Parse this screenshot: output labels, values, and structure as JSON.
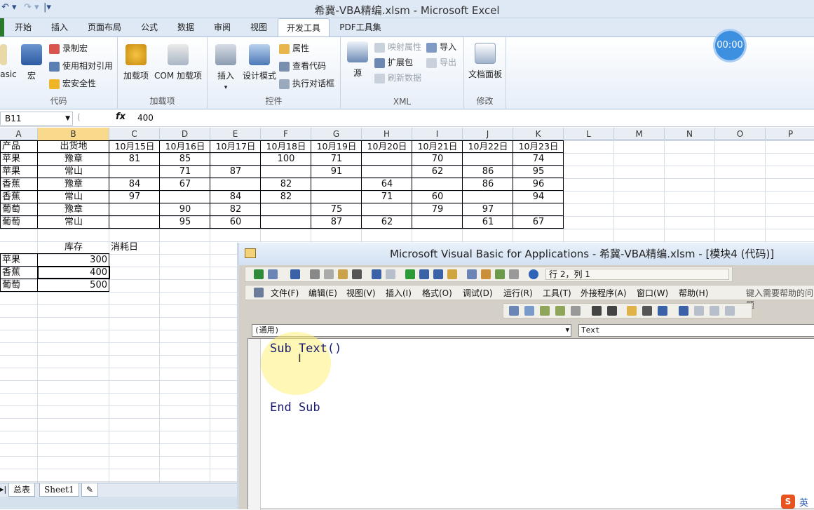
{
  "window": {
    "title": "希冀-VBA精编.xlsm - Microsoft Excel"
  },
  "ribbon": {
    "tabs": [
      "开始",
      "插入",
      "页面布局",
      "公式",
      "数据",
      "审阅",
      "视图",
      "开发工具",
      "PDF工具集"
    ],
    "active_tab": "开发工具",
    "groups": {
      "code": {
        "label": "代码",
        "basic": "asic",
        "macro": "宏",
        "record": "录制宏",
        "relative": "使用相对引用",
        "security": "宏安全性"
      },
      "addins": {
        "label": "加载项",
        "addin": "加载项",
        "com": "COM 加载项"
      },
      "controls": {
        "label": "控件",
        "insert": "插入",
        "design": "设计模式",
        "props": "属性",
        "viewcode": "查看代码",
        "dialog": "执行对话框"
      },
      "xml": {
        "label": "XML",
        "source": "源",
        "mapprops": "映射属性",
        "expand": "扩展包",
        "refresh": "刷新数据",
        "import": "导入",
        "export": "导出"
      },
      "modify": {
        "label": "修改",
        "docpanel": "文档面板"
      }
    }
  },
  "timer": "00:00",
  "formula_bar": {
    "name_box": "B11",
    "fx": "fx",
    "value": "400"
  },
  "grid": {
    "columns": [
      "A",
      "B",
      "C",
      "D",
      "E",
      "F",
      "G",
      "H",
      "I",
      "J",
      "K",
      "L",
      "M",
      "N",
      "O",
      "P"
    ],
    "header_row": [
      "产品",
      "出货地",
      "10月15日",
      "10月16日",
      "10月17日",
      "10月18日",
      "10月19日",
      "10月20日",
      "10月21日",
      "10月22日",
      "10月23日"
    ],
    "rows": [
      [
        "苹果",
        "豫章",
        "81",
        "85",
        "",
        "100",
        "71",
        "",
        "70",
        "",
        "74"
      ],
      [
        "苹果",
        "常山",
        "",
        "71",
        "87",
        "",
        "91",
        "",
        "62",
        "86",
        "95"
      ],
      [
        "香蕉",
        "豫章",
        "84",
        "67",
        "",
        "82",
        "",
        "64",
        "",
        "86",
        "96"
      ],
      [
        "香蕉",
        "常山",
        "97",
        "",
        "84",
        "82",
        "",
        "71",
        "60",
        "",
        "94"
      ],
      [
        "葡萄",
        "豫章",
        "",
        "90",
        "82",
        "",
        "75",
        "",
        "79",
        "97",
        ""
      ],
      [
        "葡萄",
        "常山",
        "",
        "95",
        "60",
        "",
        "87",
        "62",
        "",
        "61",
        "67"
      ]
    ],
    "stock_header": [
      "",
      "库存",
      "消耗日"
    ],
    "stock_rows": [
      [
        "苹果",
        "300"
      ],
      [
        "香蕉",
        "400"
      ],
      [
        "葡萄",
        "500"
      ]
    ]
  },
  "sheet_tabs": [
    "总表",
    "Sheet1"
  ],
  "vba": {
    "title": "Microsoft Visual Basic for Applications - 希冀-VBA精编.xlsm - [模块4 (代码)]",
    "position": "行 2，列 1",
    "menus": [
      "文件(F)",
      "编辑(E)",
      "视图(V)",
      "插入(I)",
      "格式(O)",
      "调试(D)",
      "运行(R)",
      "工具(T)",
      "外接程序(A)",
      "窗口(W)",
      "帮助(H)"
    ],
    "help_placeholder": "键入需要帮助的问题",
    "object_combo": "(通用)",
    "proc_combo": "Text",
    "code": [
      "Sub Text()",
      "",
      "",
      "End Sub"
    ]
  },
  "ime": {
    "label": "英"
  }
}
